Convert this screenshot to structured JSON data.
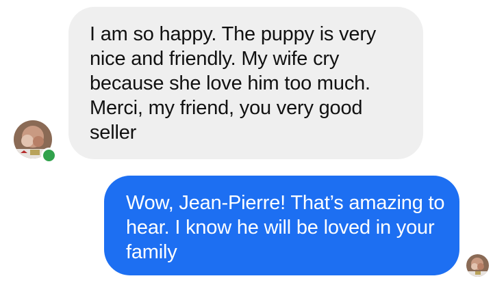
{
  "conversation": {
    "incoming_message": {
      "text": "I am so happy. The puppy is very nice and friendly. My wife cry because she love him too much. Merci, my friend, you very good seller",
      "sender_avatar": "avatar-photo-icon",
      "sender_status": "online"
    },
    "outgoing_message": {
      "text": "Wow, Jean-Pierre! That’s amazing to hear. I know he will be loved in your family",
      "seen_avatar": "avatar-photo-icon"
    }
  },
  "colors": {
    "incoming_bubble": "#efefef",
    "outgoing_bubble": "#1d6ff2",
    "online": "#31a24c"
  }
}
